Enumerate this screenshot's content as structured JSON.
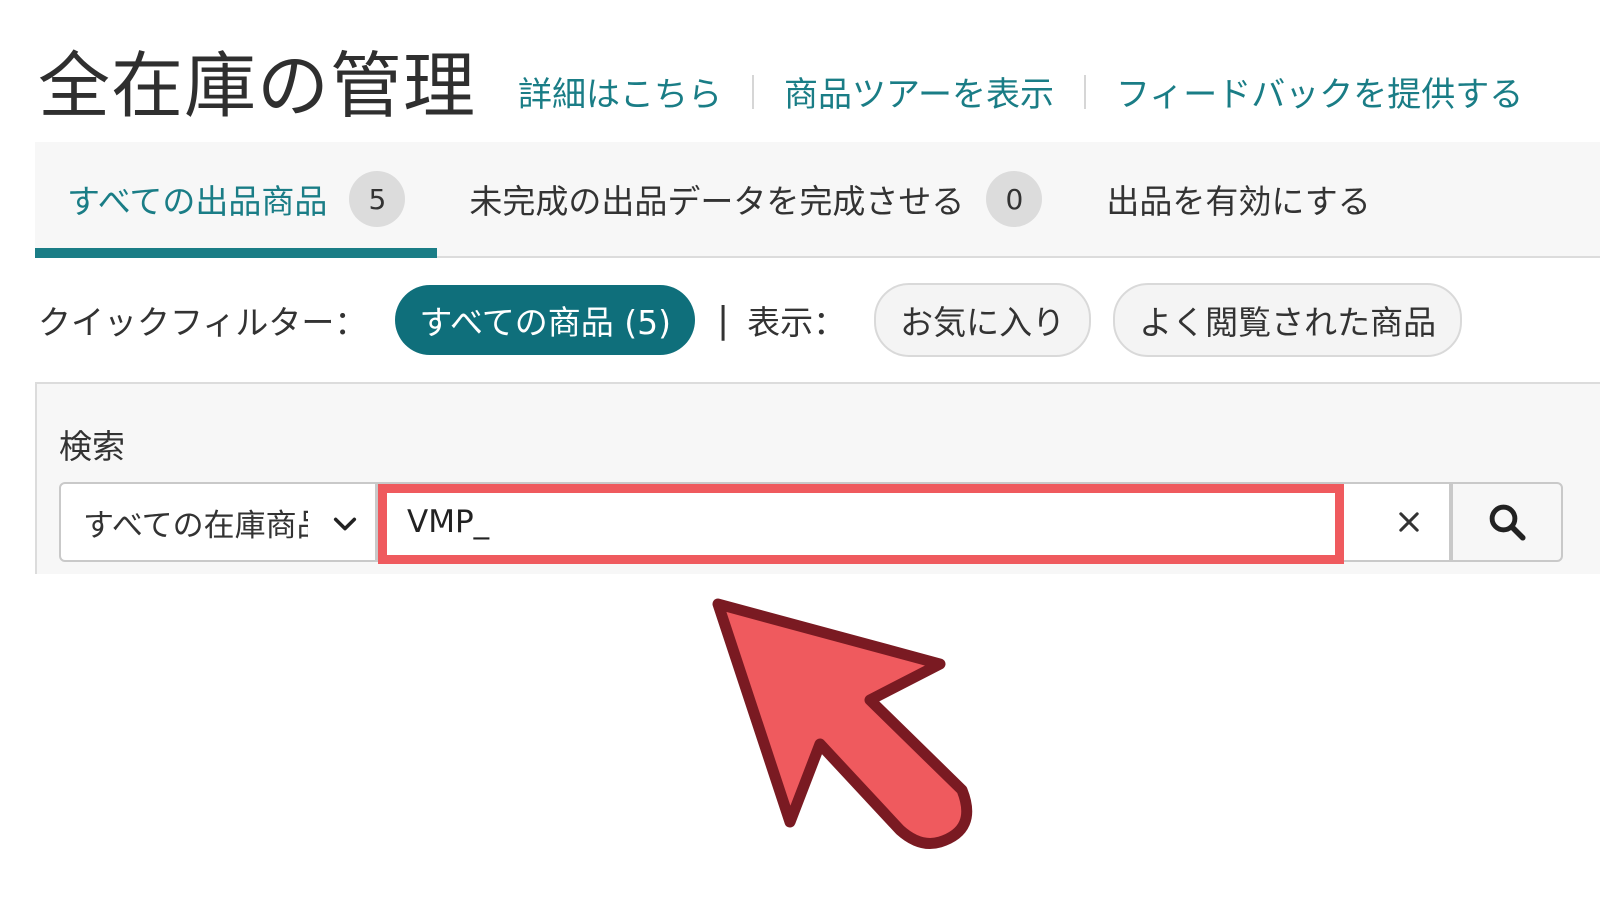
{
  "header": {
    "title": "全在庫の管理",
    "links": [
      "詳細はこちら",
      "商品ツアーを表示",
      "フィードバックを提供する"
    ]
  },
  "tabs": [
    {
      "label": "すべての出品商品",
      "count": "5",
      "active": true
    },
    {
      "label": "未完成の出品データを完成させる",
      "count": "0",
      "active": false
    },
    {
      "label": "出品を有効にする",
      "active": false
    }
  ],
  "quick_filter": {
    "label": "クイックフィルター：",
    "all_products": "すべての商品 (5)",
    "separator": "|",
    "display_label": "表示：",
    "favorites": "お気に入り",
    "most_viewed": "よく閲覧された商品"
  },
  "search": {
    "heading": "検索",
    "scope_value": "すべての在庫商品",
    "input_value": "VMP_",
    "clear_icon": "close-icon",
    "search_icon": "search-icon"
  },
  "colors": {
    "accent": "#1a7d86",
    "pill_primary": "#0f6f7b",
    "annotation_red": "#ef5a5e",
    "annotation_outline": "#7a1a22"
  }
}
